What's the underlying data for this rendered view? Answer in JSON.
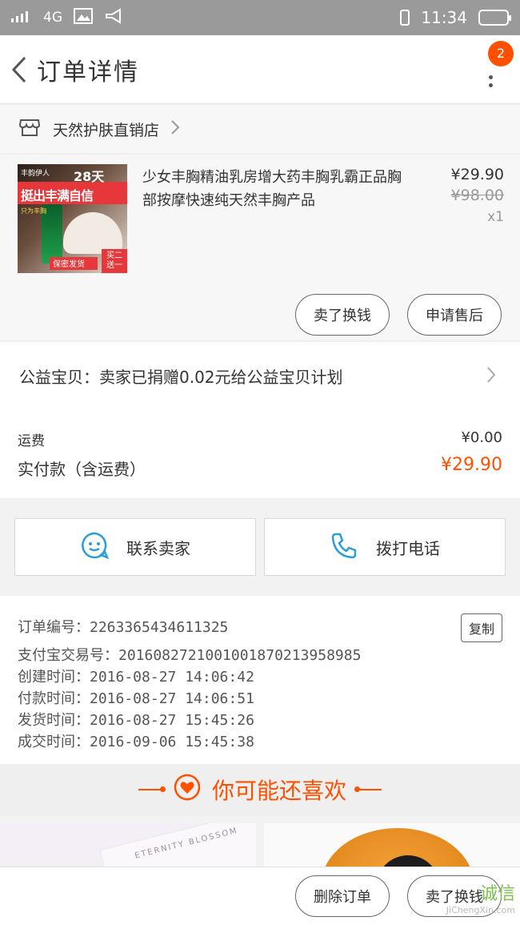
{
  "status_bar": {
    "network": "4G",
    "time": "11:34"
  },
  "header": {
    "title": "订单详情",
    "badge_count": "2"
  },
  "shop": {
    "name": "天然护肤直销店"
  },
  "product": {
    "title": "少女丰胸精油乳房增大药丰胸乳霸正品胸部按摩快速纯天然丰胸产品",
    "price": "¥29.90",
    "original_price": "¥98.00",
    "quantity": "x1",
    "image_text": {
      "brand": "丰韵伊人",
      "days": "28天",
      "headline": "挺出丰满自信",
      "sub": "只为丰胸",
      "foot": "保密发货",
      "corner": "买二送一"
    },
    "remind_button": "卖了换钱",
    "after_sale_button": "申请售后"
  },
  "charity": {
    "text": "公益宝贝：卖家已捐赠0.02元给公益宝贝计划"
  },
  "totals": {
    "shipping_label": "运费",
    "shipping_value": "¥0.00",
    "paid_label": "实付款（含运费）",
    "paid_value": "¥29.90"
  },
  "actions": {
    "contact_seller": "联系卖家",
    "call_phone": "拨打电话"
  },
  "order_info": {
    "order_number": "订单编号：2263365434611325",
    "copy_button": "复制",
    "alipay_number": "支付宝交易号：2016082721001001870213958985",
    "created": "创建时间：2016-08-27 14:06:42",
    "paid": "付款时间：2016-08-27 14:06:51",
    "shipped": "发货时间：2016-08-27 15:45:26",
    "completed": "成交时间：2016-09-06 15:45:38"
  },
  "recommend": {
    "title": "你可能还喜欢",
    "card_text": "ETERNITY BLOSSOM"
  },
  "bottom_bar": {
    "delete_order": "删除订单",
    "sell_button": "卖了换钱"
  },
  "watermark": {
    "brand": "诚信",
    "site": "JiChengXin.com"
  },
  "colors": {
    "accent": "#ff5000",
    "status_bar": "#9a9a9a",
    "icon_blue": "#2aa0d6"
  }
}
